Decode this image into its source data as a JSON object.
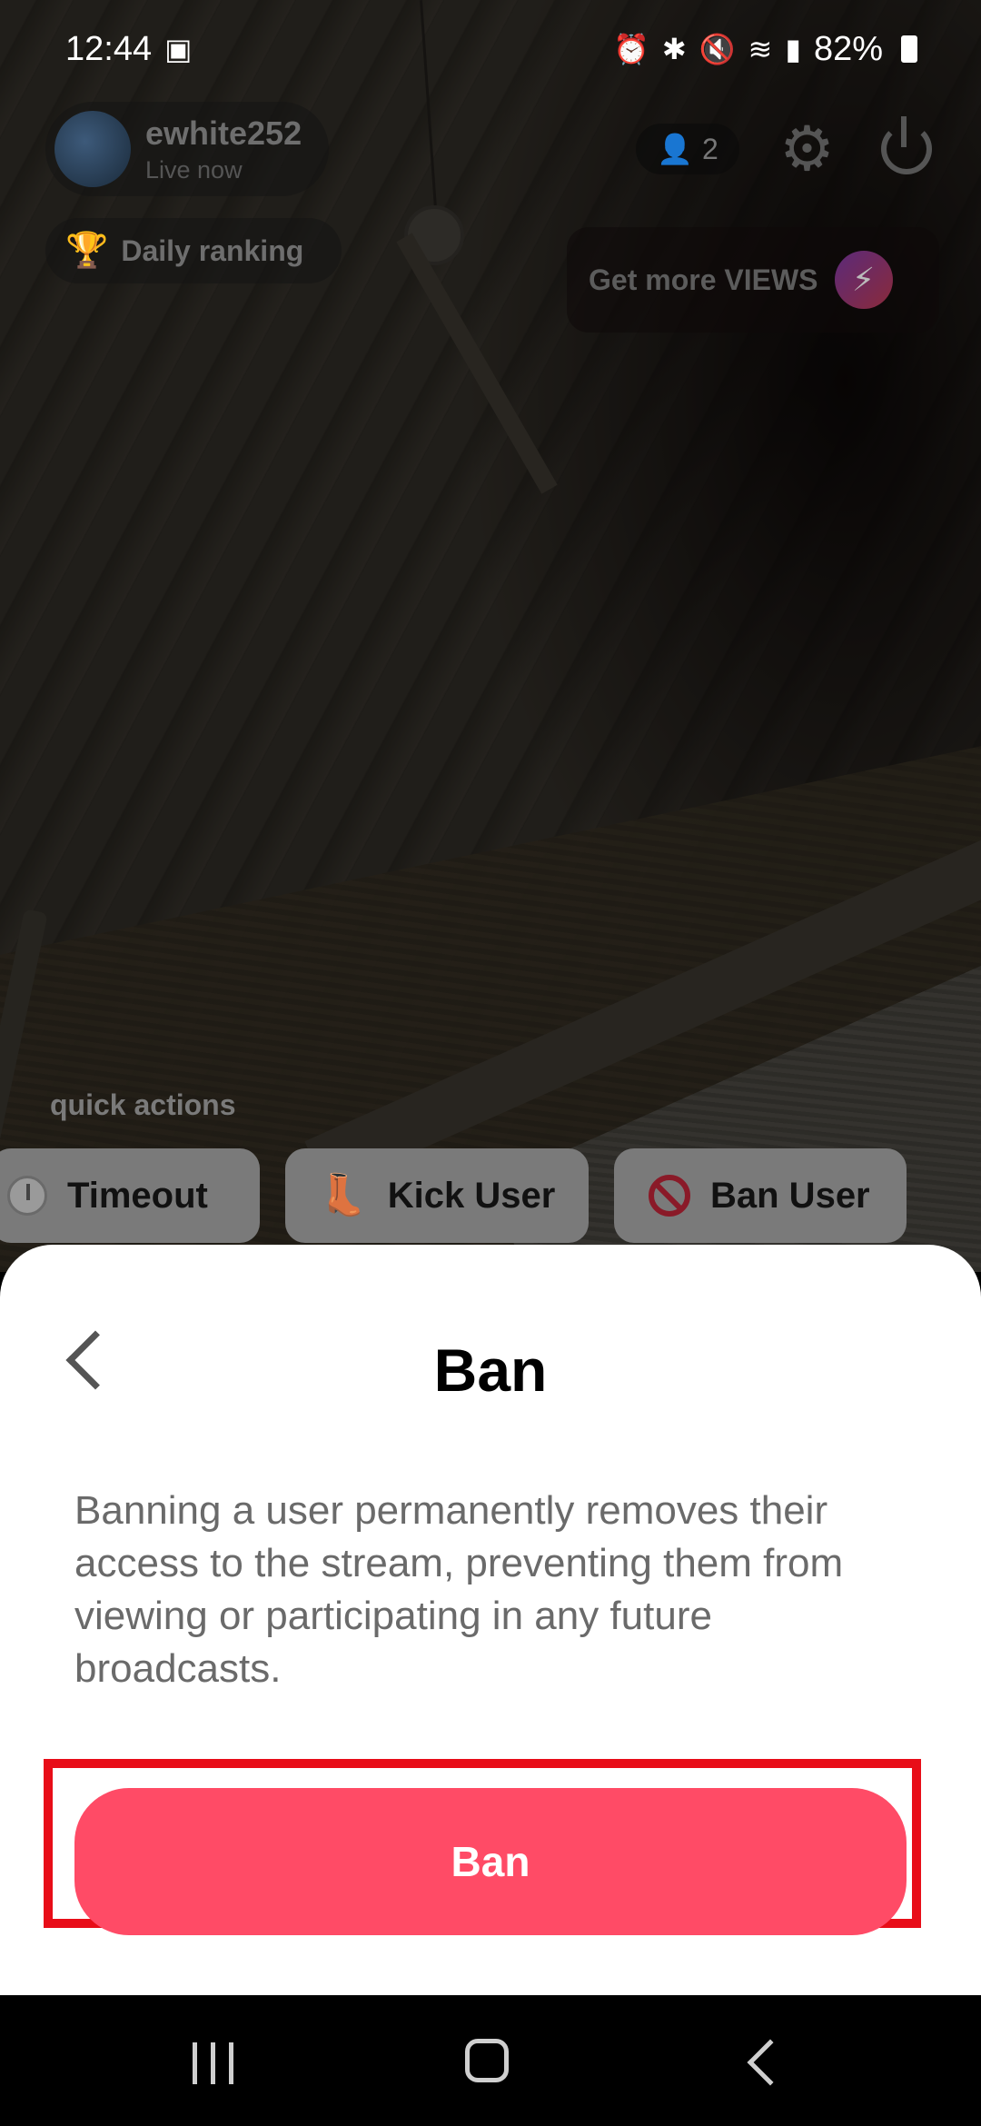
{
  "status_bar": {
    "time": "12:44",
    "battery": "82%"
  },
  "stream": {
    "username": "ewhite252",
    "live_status": "Live now",
    "daily_ranking": "Daily ranking",
    "viewer_count": "2",
    "get_views": "Get more VIEWS"
  },
  "quick_actions": {
    "label": "quick actions",
    "items": [
      {
        "label": "Timeout",
        "icon": "timer-icon"
      },
      {
        "label": "Kick User",
        "icon": "boot-icon"
      },
      {
        "label": "Ban User",
        "icon": "no-entry-icon"
      }
    ]
  },
  "sheet": {
    "title": "Ban",
    "description": "Banning a user permanently removes their access to the stream, preventing them from viewing or participating in any future broadcasts.",
    "button_label": "Ban"
  },
  "colors": {
    "ban_button": "#ff4b66",
    "highlight": "#e80d18"
  }
}
